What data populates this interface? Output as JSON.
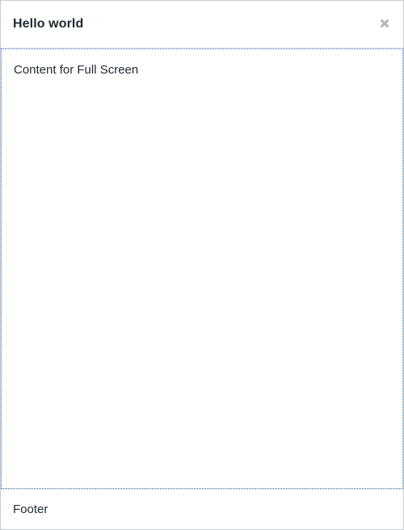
{
  "dialog": {
    "title": "Hello world",
    "close_icon": "close-icon",
    "body_text": "Content for Full Screen",
    "footer_text": "Footer"
  },
  "colors": {
    "border": "#c8ccd0",
    "focus_outline": "#4d7ec2",
    "close_icon": "#b4b8bc",
    "text": "#1f2933"
  }
}
